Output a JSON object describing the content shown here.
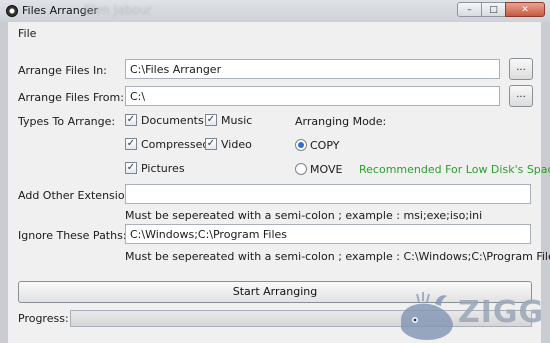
{
  "window": {
    "title": "Files Arranger",
    "ghost_title": "Elen Jabour",
    "minimize_glyph": "–",
    "maximize_glyph": "□",
    "close_glyph": "✕"
  },
  "menu": {
    "file": "File"
  },
  "arrange_in": {
    "label": "Arrange Files In:",
    "value": "C:\\Files Arranger",
    "browse": "..."
  },
  "arrange_from": {
    "label": "Arrange Files From:",
    "value": "C:\\",
    "browse": "..."
  },
  "types": {
    "label": "Types To Arrange:",
    "items": [
      {
        "label": "Documents",
        "checked": true
      },
      {
        "label": "Music",
        "checked": true
      },
      {
        "label": "Compressed",
        "checked": true
      },
      {
        "label": "Video",
        "checked": true
      },
      {
        "label": "Pictures",
        "checked": true
      }
    ],
    "check_glyph": "✓"
  },
  "mode": {
    "label": "Arranging Mode:",
    "options": [
      {
        "label": "COPY",
        "selected": true
      },
      {
        "label": "MOVE",
        "selected": false
      }
    ],
    "recommendation": "Recommended For Low Disk's Space"
  },
  "other_ext": {
    "label": "Add Other Extensions:",
    "value": "",
    "hint": "Must be sepereated with a semi-colon ; example : msi;exe;iso;ini"
  },
  "ignore": {
    "label": "Ignore These Paths:",
    "value": "C:\\Windows;C:\\Program Files",
    "hint": "Must be sepereated with a semi-colon ; example : C:\\Windows;C:\\Program Files"
  },
  "start_button": "Start Arranging",
  "progress": {
    "label": "Progress:",
    "fraction": 0.0
  },
  "watermark": {
    "text": "ZIGG"
  },
  "colors": {
    "accent_green": "#2aa02a",
    "close_red": "#c75a43",
    "radio_blue": "#2d6fd6"
  }
}
